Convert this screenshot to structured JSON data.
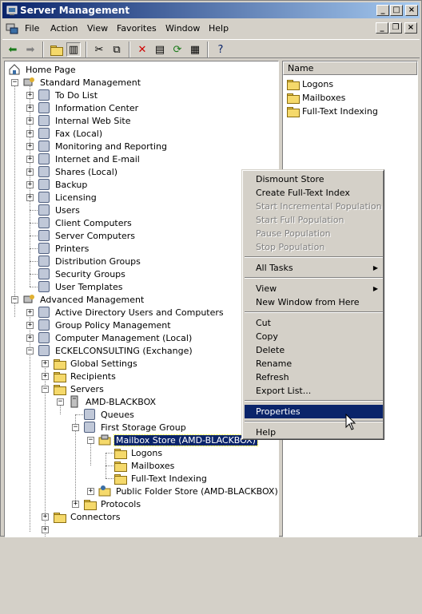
{
  "window": {
    "title": "Server Management",
    "controls": {
      "minimize": "_",
      "maximize": "□",
      "close": "×"
    },
    "mdi_controls": {
      "minimize": "_",
      "restore": "❐",
      "close": "×"
    }
  },
  "menubar": {
    "items": [
      {
        "label": "File"
      },
      {
        "label": "Action"
      },
      {
        "label": "View"
      },
      {
        "label": "Favorites"
      },
      {
        "label": "Window"
      },
      {
        "label": "Help"
      }
    ]
  },
  "toolbar": {
    "icons": [
      "back-icon",
      "forward-icon",
      "up-folder-icon",
      "show-hide-tree-icon",
      "cut-icon",
      "copy-icon",
      "delete-icon",
      "properties-icon",
      "refresh-icon",
      "export-list-icon",
      "help-icon"
    ]
  },
  "tree": {
    "nodes": [
      {
        "label": "Home Page"
      },
      {
        "label": "Standard Management"
      },
      {
        "label": "To Do List"
      },
      {
        "label": "Information Center"
      },
      {
        "label": "Internal Web Site"
      },
      {
        "label": "Fax (Local)"
      },
      {
        "label": "Monitoring and Reporting"
      },
      {
        "label": "Internet and E-mail"
      },
      {
        "label": "Shares (Local)"
      },
      {
        "label": "Backup"
      },
      {
        "label": "Licensing"
      },
      {
        "label": "Users"
      },
      {
        "label": "Client Computers"
      },
      {
        "label": "Server Computers"
      },
      {
        "label": "Printers"
      },
      {
        "label": "Distribution Groups"
      },
      {
        "label": "Security Groups"
      },
      {
        "label": "User Templates"
      },
      {
        "label": "Advanced Management"
      },
      {
        "label": "Active Directory Users and Computers"
      },
      {
        "label": "Group Policy Management"
      },
      {
        "label": "Computer Management (Local)"
      },
      {
        "label": "ECKELCONSULTING (Exchange)"
      },
      {
        "label": "Global Settings"
      },
      {
        "label": "Recipients"
      },
      {
        "label": "Servers"
      },
      {
        "label": "AMD-BLACKBOX"
      },
      {
        "label": "Queues"
      },
      {
        "label": "First Storage Group"
      },
      {
        "label": "Mailbox Store (AMD-BLACKBOX)"
      },
      {
        "label": "Logons"
      },
      {
        "label": "Mailboxes"
      },
      {
        "label": "Full-Text Indexing"
      },
      {
        "label": "Public Folder Store (AMD-BLACKBOX)"
      },
      {
        "label": "Protocols"
      },
      {
        "label": "Connectors"
      }
    ]
  },
  "details": {
    "column_header": "Name",
    "items": [
      {
        "label": "Logons"
      },
      {
        "label": "Mailboxes"
      },
      {
        "label": "Full-Text Indexing"
      }
    ]
  },
  "context_menu": {
    "items": [
      {
        "label": "Dismount Store"
      },
      {
        "label": "Create Full-Text Index"
      },
      {
        "label": "Start Incremental Population"
      },
      {
        "label": "Start Full Population"
      },
      {
        "label": "Pause Population"
      },
      {
        "label": "Stop Population"
      },
      {
        "label": "All Tasks"
      },
      {
        "label": "View"
      },
      {
        "label": "New Window from Here"
      },
      {
        "label": "Cut"
      },
      {
        "label": "Copy"
      },
      {
        "label": "Delete"
      },
      {
        "label": "Rename"
      },
      {
        "label": "Refresh"
      },
      {
        "label": "Export List..."
      },
      {
        "label": "Properties"
      },
      {
        "label": "Help"
      }
    ]
  },
  "colors": {
    "title_start": "#0a246a",
    "title_end": "#a6caf0",
    "selection": "#0a246a",
    "face": "#d4d0c8"
  }
}
